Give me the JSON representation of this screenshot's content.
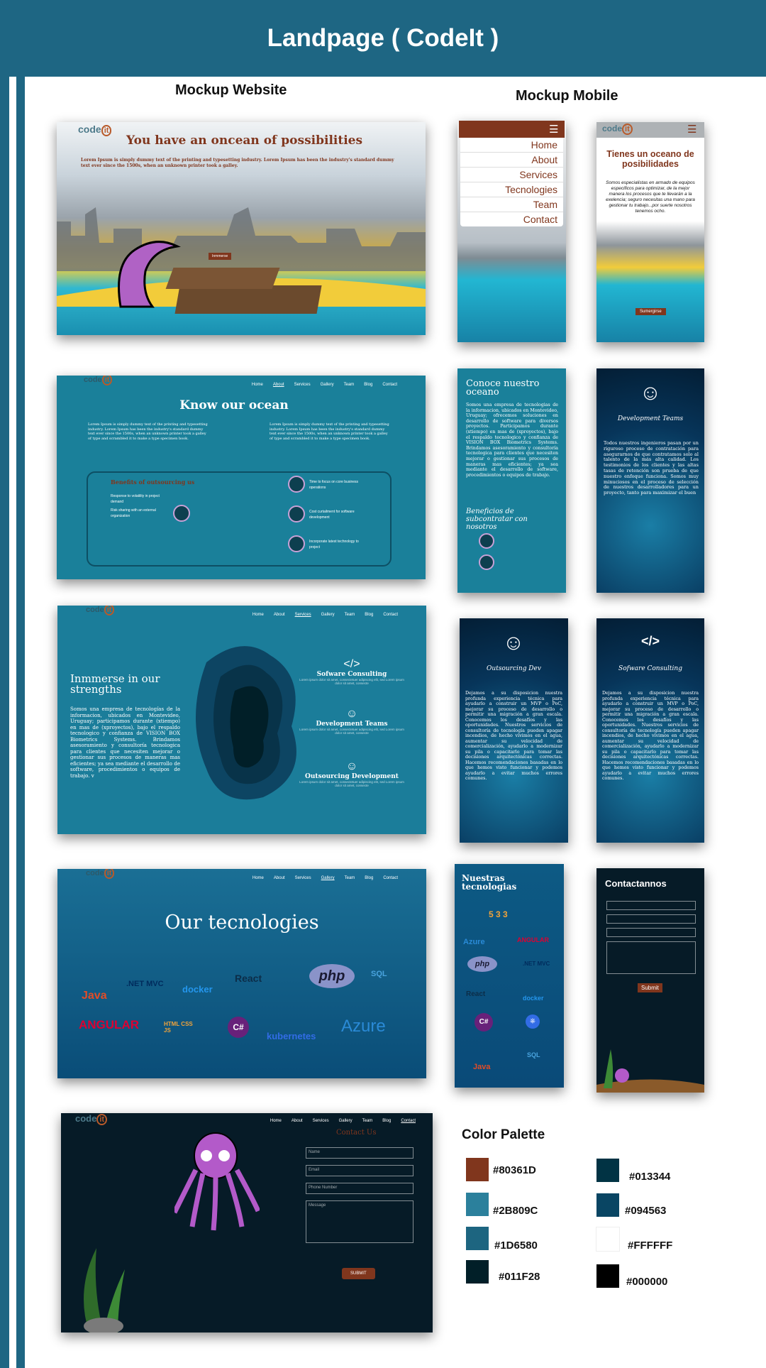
{
  "title": "Landpage ( CodeIt )",
  "website_heading": "Mockup Website",
  "mobile_heading": "Mockup Mobile",
  "logo": {
    "text": "code",
    "mark": "it"
  },
  "nav": [
    "Home",
    "About",
    "Services",
    "Gallery",
    "Team",
    "Blog",
    "Contact"
  ],
  "web1": {
    "title": "You have an oncean of possibilities",
    "text": "Lorem Ipsum is simply dummy text of the printing and typesetting industry. Lorem Ipsum has been the industry's standard dummy text ever since the 1500s, when an unknown printer took a galley.",
    "button": "Inmmerse"
  },
  "web2": {
    "title": "Know our ocean",
    "col1": "Lorem Ipsum is simply dummy text of the printing and typesetting industry. Lorem Ipsum has been the industry's standard dummy text ever since the 1500s, when an unknown printer took a galley of type and scrambled it to make a type specimen book.",
    "col2": "Lorem Ipsum is simply dummy text of the printing and typesetting industry. Lorem Ipsum has been the industry's standard dummy text ever since the 1500s, when an unknown printer took a galley of type and scrambled it to make a type specimen book.",
    "benefits_title": "Benefits of outsourcing us",
    "benefit_left1": "Response to volatility in project demand",
    "benefit_left2": "Risk sharing with an external organization",
    "benefit_right1": "Time to focus on core business operations",
    "benefit_right2": "Cost curtailment for software development",
    "benefit_right3": "Incorporate latest technology to project"
  },
  "web3": {
    "title": "Inmmerse in our strengths",
    "text": "Somos una empresa de tecnologías de la informacion, ubicados en Montevideo, Uruguay; participamos durante (xtiempo) en mas de (xproyectos), bajo el respaldo tecnologico y confianza de VISION BOX Biometrics Systems. Brindamos asesoramiento y consultoría tecnologica para clientes que necesiten mejorar o gestionar sus procesos de maneras mas eficientes; ya sea mediante el desarrollo de software, procedimientos o equipos de trabajo. v",
    "s1": "Sofware Consulting",
    "s2": "Development Teams",
    "s3": "Outsourcing Development",
    "lorem": "Lorem ipsum dolor sit amet, consectetuer adipiscing elit, sed Lorem ipsum dolor sit amet, consecte"
  },
  "web4": {
    "title": "Our tecnologies",
    "row1": [
      "Java",
      ".NET MVC",
      "docker",
      "React",
      "php",
      "SQL"
    ],
    "row2": [
      "ANGULAR",
      "HTML CSS JS",
      "C#",
      "kubernetes",
      "Azure"
    ]
  },
  "web5": {
    "title": "Contact Us",
    "fields": [
      "Name",
      "Email",
      "Phone Number",
      "Message"
    ],
    "button": "SUBMIT"
  },
  "m1": {
    "menu": [
      "Home",
      "About",
      "Services",
      "Tecnologies",
      "Team",
      "Contact"
    ]
  },
  "m2": {
    "title": "Tienes un oceano de posibilidades",
    "text": "Somos especialistas en armado de equipos especificos para optimizar, de la mejor manera los procesos que te llevarán a la exelencia; seguro necesitas una mano para gestionar tu trabajo...por suerte nosotros tenemos ocho.",
    "button": "Sumergirse"
  },
  "m3": {
    "title": "Conoce nuestro oceano",
    "text": "Somos una empresa de tecnologias de la informacion, ubicados en Montevideo, Uruguay; ofrecemos soluciones en desarrollo de software para diversos proyectos. Participamos durante (xtiempo) en mas de (xproyectos), bajo el respaldo tecnologico y confianza de VISION BOX Biometrics Systems. Brindamos asesoramiento y consultoría tecnologica para clientes que necesiten mejorar o gestionar sus procesos de maneras mas eficientes; ya sea mediante el desarrollo de software, procedimientos o equipos de trabajo.",
    "sub": "Beneficios de subcontratar con nosotros"
  },
  "m4": {
    "title": "Development Teams",
    "text": "Todos nuestros ingenieros pasan por un riguroso proceso de contratación para asegurarnos de que contratamos solo al talento de la más alta calidad. Los testimonios de los clientes y las altas tasas de retención son prueba de que nuestro enfoque funciona. Somos muy minuciosos en el proceso de selección de nuestros desarrolladores para un proyecto, tanto para maximizar el buen"
  },
  "m5": {
    "title": "Outsourcing Dev",
    "text": "Dejamos a su disposicion nuestra profunda experiencia técnica para ayudarlo a construir un MVP o PoC, mejorar su proceso de desarrollo o permitir una migración a gran escala. Conocemos los desafíos y las oportunidades. Nuestros servicios de consultoría de tecnología pueden apagar incendios, de hecho vivimos en el agua, aumentar su velocidad de comercialización, ayudarlo a modernizar su pila o capacitarlo para tomar las decisiones arquitectónicas correctas. Hacemos recomendaciones basadas en lo que hemos visto funcionar y podemos ayudarlo a evitar muchos errores comunes."
  },
  "m6": {
    "title": "Sofware Consulting",
    "text": "Dejamos a su disposicion nuestra profunda experiencia técnica para ayudarlo a construir un MVP o PoC, mejorar su proceso de desarrollo o permitir una migración a gran escala. Conocemos los desafíos y las oportunidades. Nuestros servicios de consultoría de tecnología pueden apagar incendios, de hecho vivimos en el agua, aumentar su velocidad de comercialización, ayudarlo a modernizar su pila o capacitarlo para tomar las decisiones arquitectónicas correctas. Hacemos recomendaciones basadas en lo que hemos visto funcionar y podemos ayudarlo a evitar muchos errores comunes."
  },
  "m7": {
    "title": "Nuestras tecnologias",
    "items": [
      "Azure",
      "ANGULAR",
      "php",
      ".NET MVC",
      "React",
      "docker",
      "Java",
      "SQL"
    ]
  },
  "m8": {
    "title": "Contactannos",
    "button": "Submit"
  },
  "palette": {
    "title": "Color Palette",
    "colors": [
      {
        "hex": "#80361D",
        "label": "#80361D"
      },
      {
        "hex": "#2B809C",
        "label": "#2B809C"
      },
      {
        "hex": "#1D6580",
        "label": "#1D6580"
      },
      {
        "hex": "#011F28",
        "label": "#011F28"
      },
      {
        "hex": "#013344",
        "label": "#013344"
      },
      {
        "hex": "#094563",
        "label": "#094563"
      },
      {
        "hex": "#FFFFFF",
        "label": "#FFFFFF"
      },
      {
        "hex": "#000000",
        "label": "#000000"
      }
    ]
  }
}
